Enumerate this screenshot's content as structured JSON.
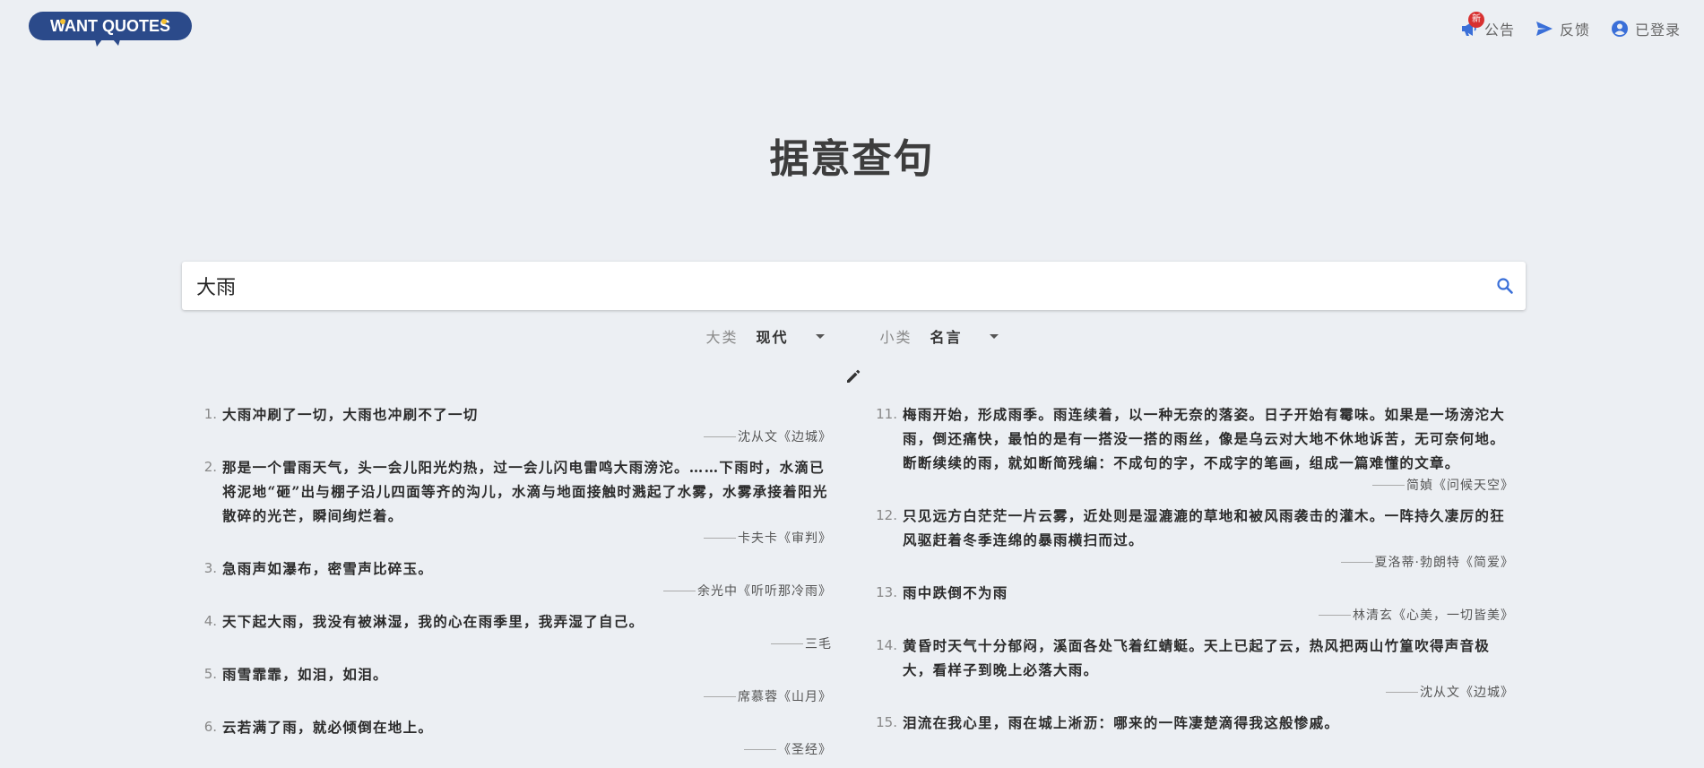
{
  "header": {
    "logo_text": "WANT QUOTES",
    "nav": {
      "announcement_label": "公告",
      "new_badge": "新",
      "feedback_label": "反馈",
      "account_label": "已登录"
    }
  },
  "page_title": "据意查句",
  "search": {
    "value": "大雨"
  },
  "filters": {
    "category_label": "大类",
    "category_value": "现代",
    "subcategory_label": "小类",
    "subcategory_value": "名言"
  },
  "colors": {
    "brand": "#2b4a8a",
    "accent_icon": "#3a6fd8",
    "badge": "#d83131",
    "logo_yellow": "#f5c130"
  },
  "quotes_left": [
    {
      "num": "1.",
      "text": "大雨冲刷了一切，大雨也冲刷不了一切",
      "source": "沈从文《边城》"
    },
    {
      "num": "2.",
      "text": "那是一个雷雨天气，头一会儿阳光灼热，过一会儿闪电雷鸣大雨滂沱。……下雨时，水滴已将泥地“砸”出与棚子沿儿四面等齐的沟儿，水滴与地面接触时溅起了水雾，水雾承接着阳光散碎的光芒，瞬间绚烂着。",
      "source": "卡夫卡《审判》"
    },
    {
      "num": "3.",
      "text": "急雨声如瀑布，密雪声比碎玉。",
      "source": "余光中《听听那冷雨》"
    },
    {
      "num": "4.",
      "text": "天下起大雨，我没有被淋湿，我的心在雨季里，我弄湿了自己。",
      "source": "三毛"
    },
    {
      "num": "5.",
      "text": "雨雪霏霏，如泪，如泪。",
      "source": "席慕蓉《山月》"
    },
    {
      "num": "6.",
      "text": "云若满了雨，就必倾倒在地上。",
      "source": "《圣经》"
    }
  ],
  "quotes_right": [
    {
      "num": "11.",
      "text": "梅雨开始，形成雨季。雨连续着，以一种无奈的落姿。日子开始有霉味。如果是一场滂沱大雨，倒还痛快，最怕的是有一搭没一搭的雨丝，像是乌云对大地不休地诉苦，无可奈何地。断断续续的雨，就如断简残编：不成句的字，不成字的笔画，组成一篇难懂的文章。",
      "source": "简媜《问候天空》"
    },
    {
      "num": "12.",
      "text": "只见远方白茫茫一片云雾，近处则是湿漉漉的草地和被风雨袭击的灌木。一阵持久凄厉的狂风驱赶着冬季连绵的暴雨横扫而过。",
      "source": "夏洛蒂·勃朗特《简爱》"
    },
    {
      "num": "13.",
      "text": "雨中跌倒不为雨",
      "source": "林清玄《心美，一切皆美》"
    },
    {
      "num": "14.",
      "text": "黄昏时天气十分郁闷，溪面各处飞着红蜻蜓。天上已起了云，热风把两山竹篁吹得声音极大，看样子到晚上必落大雨。",
      "source": "沈从文《边城》"
    },
    {
      "num": "15.",
      "text": "泪流在我心里，雨在城上淅沥：哪来的一阵凄楚滴得我这般惨戚。",
      "source": ""
    }
  ]
}
